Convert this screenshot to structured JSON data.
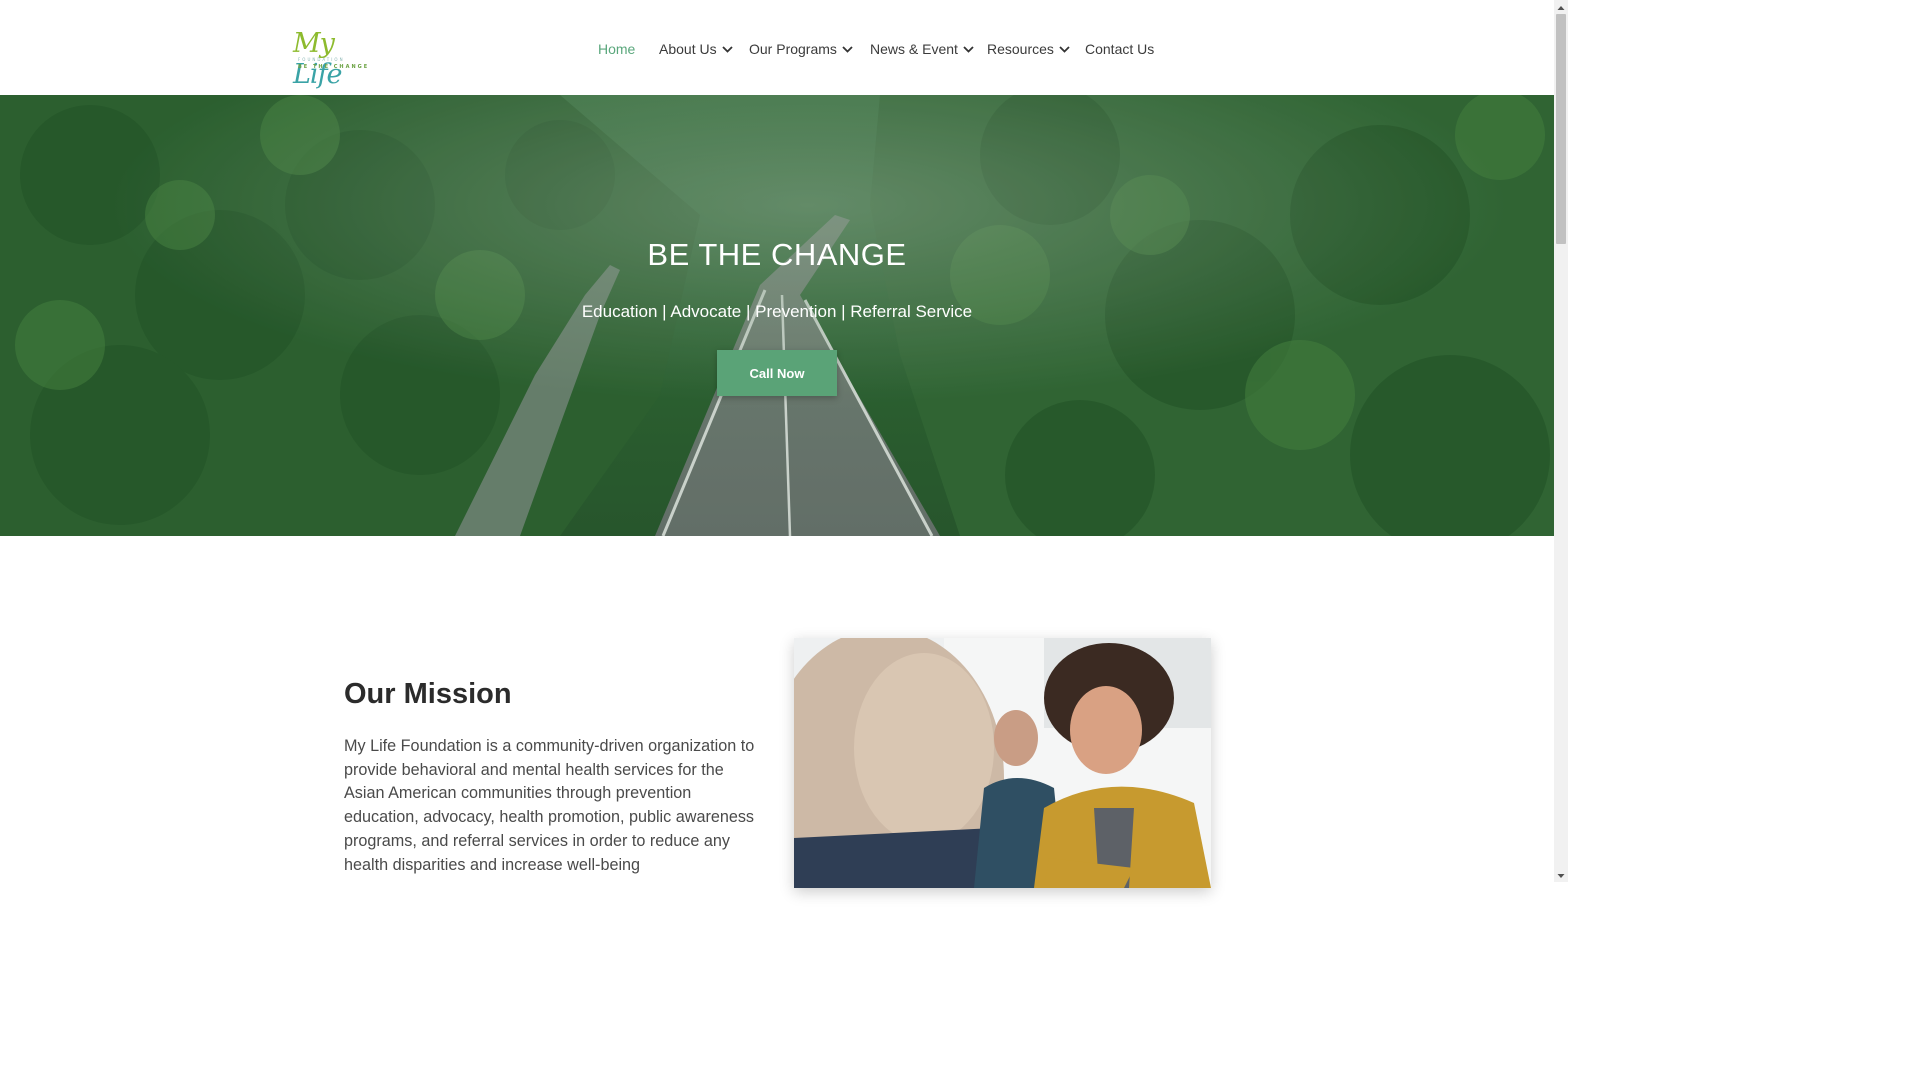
{
  "logo": {
    "my": "My",
    "life": "Life",
    "foundation": "FOUNDATION",
    "tagline": "BE THE CHANGE"
  },
  "nav": {
    "items": [
      {
        "label": "Home",
        "active": true,
        "dropdown": false
      },
      {
        "label": "About Us",
        "dropdown": true
      },
      {
        "label": "Our Programs",
        "dropdown": true
      },
      {
        "label": "News & Event",
        "dropdown": true
      },
      {
        "label": "Resources",
        "dropdown": true
      },
      {
        "label": "Contact Us",
        "dropdown": false
      }
    ]
  },
  "hero": {
    "title": "BE THE CHANGE",
    "subtitle": "Education | Advocate | Prevention | Referral Service",
    "cta_label": "Call Now"
  },
  "mission": {
    "title": "Our Mission",
    "text": "My Life Foundation is a community-driven organization to provide behavioral and mental health services for the Asian American communities through prevention education, advocacy, health promotion, public awareness programs, and referral services in order to reduce any health disparities and increase well-being"
  },
  "colors": {
    "accent": "#5aa377",
    "nav_active": "#5aa77c",
    "hero_bg": "#2e5e31"
  },
  "icons": [
    "chevron-down-icon",
    "scroll-up-arrow",
    "scroll-down-arrow"
  ]
}
